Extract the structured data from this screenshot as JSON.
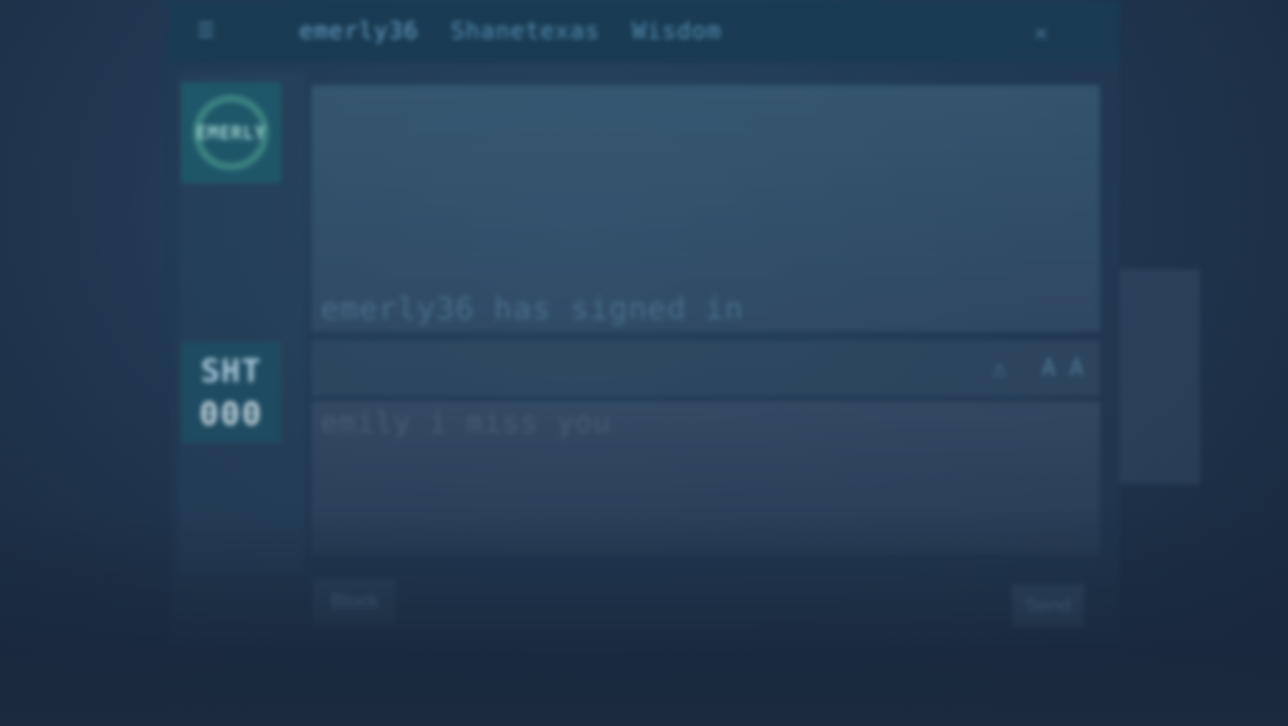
{
  "topbar": {
    "menu_icon": "menu-icon",
    "tabs": [
      {
        "label": "emerly36"
      },
      {
        "label": "Shanetexas"
      },
      {
        "label": "Wisdom"
      }
    ],
    "close_icon": "close-icon"
  },
  "messages": {
    "system": "emerly36 has signed in",
    "reply": "emily i miss you"
  },
  "avatars": [
    {
      "name": "avatar-emerly36",
      "text": "EMERLY"
    },
    {
      "name": "avatar-shanetexas",
      "top": "SHT",
      "bottom": "000"
    }
  ],
  "header_actions": [
    {
      "icon": "warning-icon",
      "glyph": "⚠"
    },
    {
      "icon": "font-size-icon",
      "glyph": "A A"
    }
  ],
  "buttons": {
    "left": "Block",
    "send": "Send"
  },
  "colors": {
    "background": "#1b2a3c",
    "topbar": "#193c55",
    "accent": "#5a93b8"
  }
}
